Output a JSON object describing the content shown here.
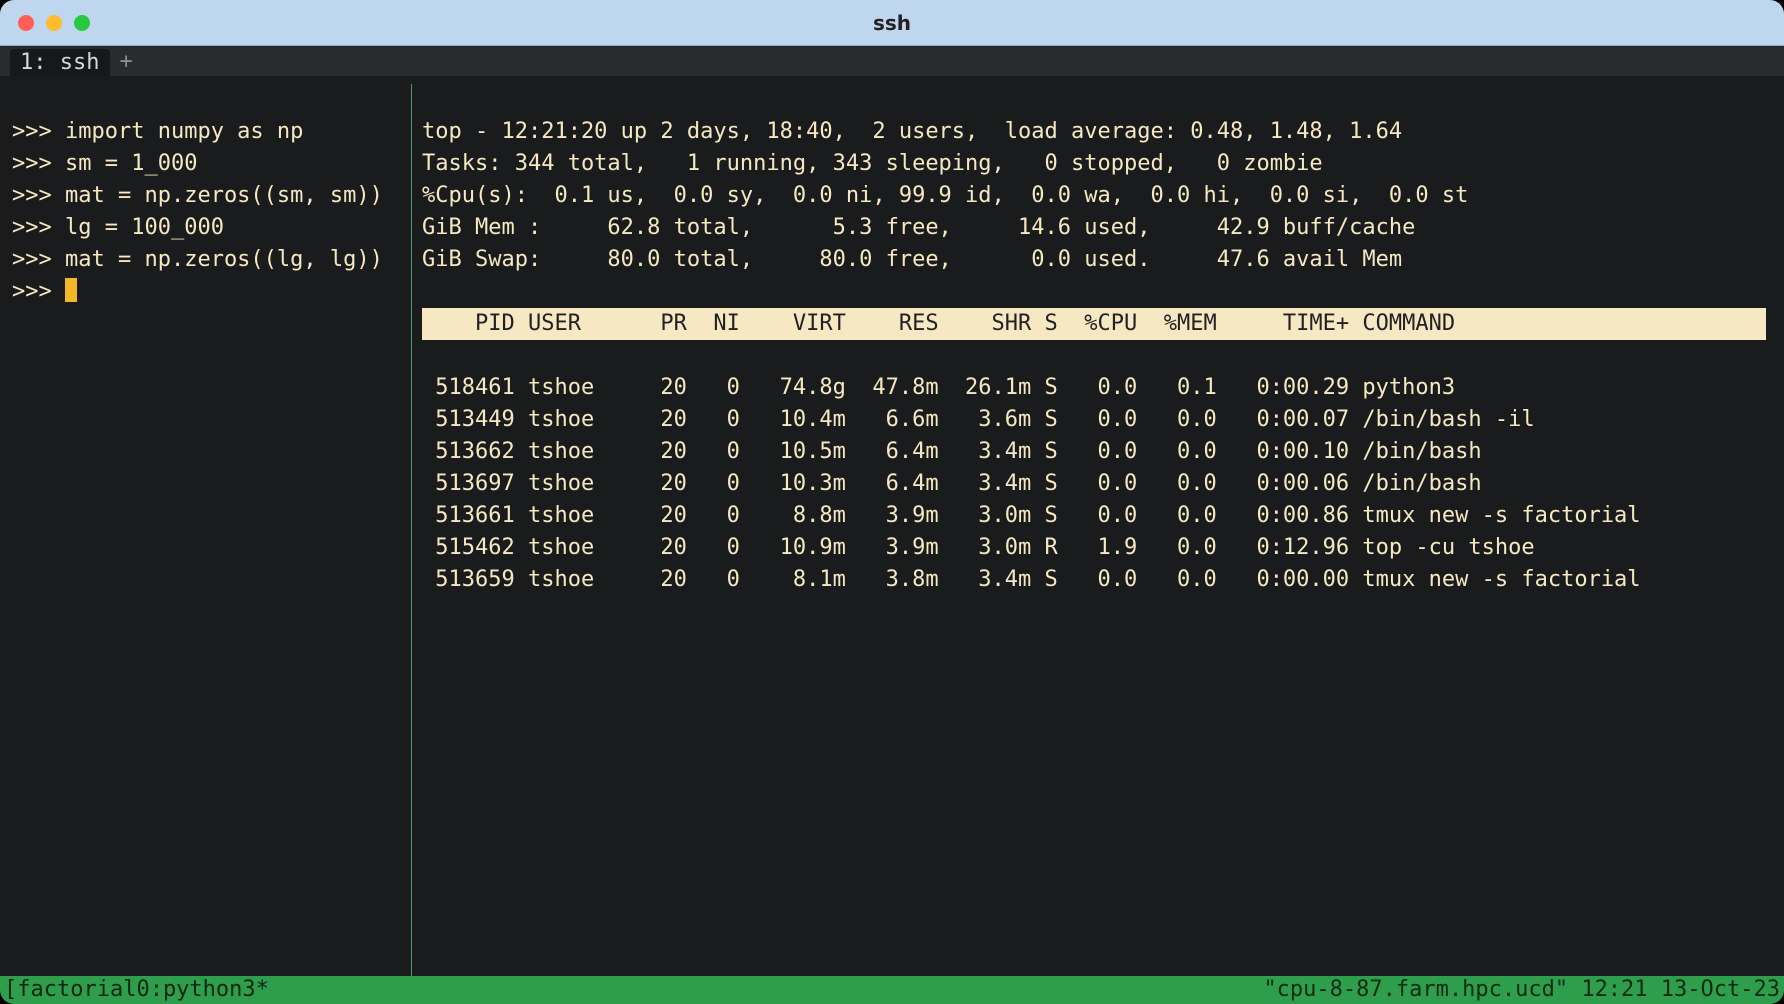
{
  "window": {
    "title": "ssh"
  },
  "tab": {
    "index": "1:",
    "name": "ssh",
    "plus": "+"
  },
  "repl": {
    "prompt": ">>>",
    "lines": [
      "import numpy as np",
      "sm = 1_000",
      "mat = np.zeros((sm, sm))",
      "lg = 100_000",
      "mat = np.zeros((lg, lg))"
    ]
  },
  "top": {
    "summary": [
      "top - 12:21:20 up 2 days, 18:40,  2 users,  load average: 0.48, 1.48, 1.64",
      "Tasks: 344 total,   1 running, 343 sleeping,   0 stopped,   0 zombie",
      "%Cpu(s):  0.1 us,  0.0 sy,  0.0 ni, 99.9 id,  0.0 wa,  0.0 hi,  0.0 si,  0.0 st",
      "GiB Mem :     62.8 total,      5.3 free,     14.6 used,     42.9 buff/cache",
      "GiB Swap:     80.0 total,     80.0 free,      0.0 used.     47.6 avail Mem"
    ],
    "header": "    PID USER      PR  NI    VIRT    RES    SHR S  %CPU  %MEM     TIME+ COMMAND",
    "rows": [
      " 518461 tshoe     20   0   74.8g  47.8m  26.1m S   0.0   0.1   0:00.29 python3",
      " 513449 tshoe     20   0   10.4m   6.6m   3.6m S   0.0   0.0   0:00.07 /bin/bash -il",
      " 513662 tshoe     20   0   10.5m   6.4m   3.4m S   0.0   0.0   0:00.10 /bin/bash",
      " 513697 tshoe     20   0   10.3m   6.4m   3.4m S   0.0   0.0   0:00.06 /bin/bash",
      " 513661 tshoe     20   0    8.8m   3.9m   3.0m S   0.0   0.0   0:00.86 tmux new -s factorial",
      " 515462 tshoe     20   0   10.9m   3.9m   3.0m R   1.9   0.0   0:12.96 top -cu tshoe",
      " 513659 tshoe     20   0    8.1m   3.8m   3.4m S   0.0   0.0   0:00.00 tmux new -s factorial"
    ]
  },
  "status": {
    "left": "[factorial0:python3*",
    "right": "\"cpu-8-87.farm.hpc.ucd\" 12:21 13-Oct-23"
  }
}
